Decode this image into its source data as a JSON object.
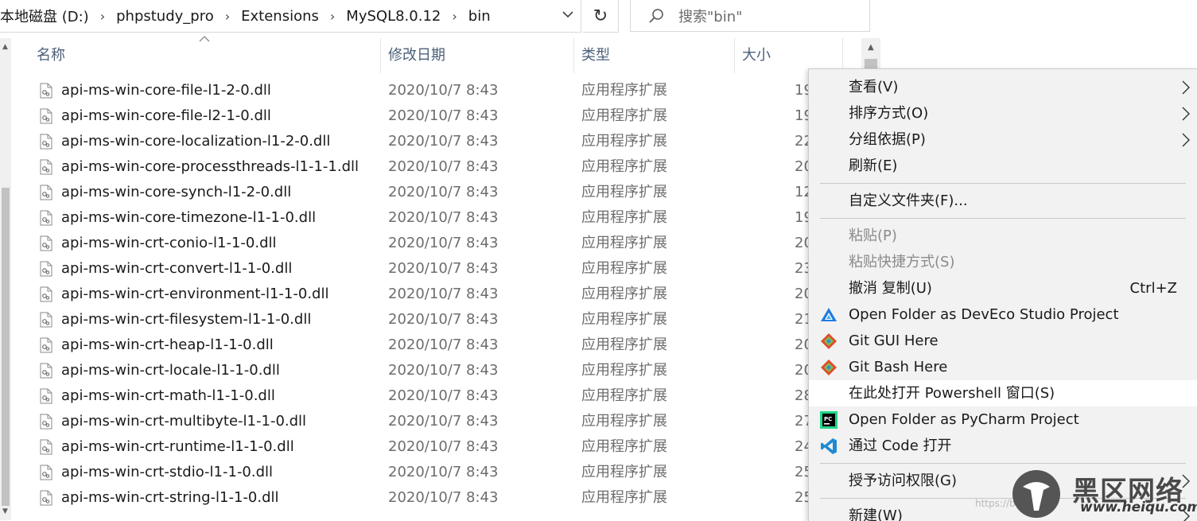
{
  "address": {
    "crumbs": [
      "本地磁盘 (D:)",
      "phpstudy_pro",
      "Extensions",
      "MySQL8.0.12",
      "bin"
    ]
  },
  "search": {
    "placeholder": "搜索\"bin\""
  },
  "columns": {
    "name": "名称",
    "date": "修改日期",
    "type": "类型",
    "size": "大小"
  },
  "files": [
    {
      "name": "api-ms-win-core-file-l1-2-0.dll",
      "date": "2020/10/7 8:43",
      "type": "应用程序扩展",
      "size": "19"
    },
    {
      "name": "api-ms-win-core-file-l2-1-0.dll",
      "date": "2020/10/7 8:43",
      "type": "应用程序扩展",
      "size": "19"
    },
    {
      "name": "api-ms-win-core-localization-l1-2-0.dll",
      "date": "2020/10/7 8:43",
      "type": "应用程序扩展",
      "size": "22"
    },
    {
      "name": "api-ms-win-core-processthreads-l1-1-1.dll",
      "date": "2020/10/7 8:43",
      "type": "应用程序扩展",
      "size": "20"
    },
    {
      "name": "api-ms-win-core-synch-l1-2-0.dll",
      "date": "2020/10/7 8:43",
      "type": "应用程序扩展",
      "size": "12"
    },
    {
      "name": "api-ms-win-core-timezone-l1-1-0.dll",
      "date": "2020/10/7 8:43",
      "type": "应用程序扩展",
      "size": "19"
    },
    {
      "name": "api-ms-win-crt-conio-l1-1-0.dll",
      "date": "2020/10/7 8:43",
      "type": "应用程序扩展",
      "size": "20"
    },
    {
      "name": "api-ms-win-crt-convert-l1-1-0.dll",
      "date": "2020/10/7 8:43",
      "type": "应用程序扩展",
      "size": "23"
    },
    {
      "name": "api-ms-win-crt-environment-l1-1-0.dll",
      "date": "2020/10/7 8:43",
      "type": "应用程序扩展",
      "size": "20"
    },
    {
      "name": "api-ms-win-crt-filesystem-l1-1-0.dll",
      "date": "2020/10/7 8:43",
      "type": "应用程序扩展",
      "size": "21"
    },
    {
      "name": "api-ms-win-crt-heap-l1-1-0.dll",
      "date": "2020/10/7 8:43",
      "type": "应用程序扩展",
      "size": "20"
    },
    {
      "name": "api-ms-win-crt-locale-l1-1-0.dll",
      "date": "2020/10/7 8:43",
      "type": "应用程序扩展",
      "size": "20"
    },
    {
      "name": "api-ms-win-crt-math-l1-1-0.dll",
      "date": "2020/10/7 8:43",
      "type": "应用程序扩展",
      "size": "28"
    },
    {
      "name": "api-ms-win-crt-multibyte-l1-1-0.dll",
      "date": "2020/10/7 8:43",
      "type": "应用程序扩展",
      "size": "27"
    },
    {
      "name": "api-ms-win-crt-runtime-l1-1-0.dll",
      "date": "2020/10/7 8:43",
      "type": "应用程序扩展",
      "size": "24"
    },
    {
      "name": "api-ms-win-crt-stdio-l1-1-0.dll",
      "date": "2020/10/7 8:43",
      "type": "应用程序扩展",
      "size": "25"
    },
    {
      "name": "api-ms-win-crt-string-l1-1-0.dll",
      "date": "2020/10/7 8:43",
      "type": "应用程序扩展",
      "size": "25"
    }
  ],
  "menu": {
    "view": "查看(V)",
    "sort": "排序方式(O)",
    "group": "分组依据(P)",
    "refresh": "刷新(E)",
    "customize": "自定义文件夹(F)...",
    "paste": "粘贴(P)",
    "paste_shortcut": "粘贴快捷方式(S)",
    "undo": "撤消 复制(U)",
    "undo_shortcut": "Ctrl+Z",
    "deveco": "Open Folder as DevEco Studio Project",
    "git_gui": "Git GUI Here",
    "git_bash": "Git Bash Here",
    "powershell": "在此处打开 Powershell 窗口(S)",
    "pycharm": "Open Folder as PyCharm Project",
    "vscode": "通过 Code 打开",
    "access": "授予访问权限(G)",
    "new": "新建(W)"
  },
  "watermark": {
    "brand": "黑区网络",
    "site": "www.heiqu.com",
    "url": "https://bl"
  },
  "colors": {
    "header_text": "#4c607a",
    "menu_bg": "#f2f2f2",
    "highlight": "#ffffff"
  }
}
